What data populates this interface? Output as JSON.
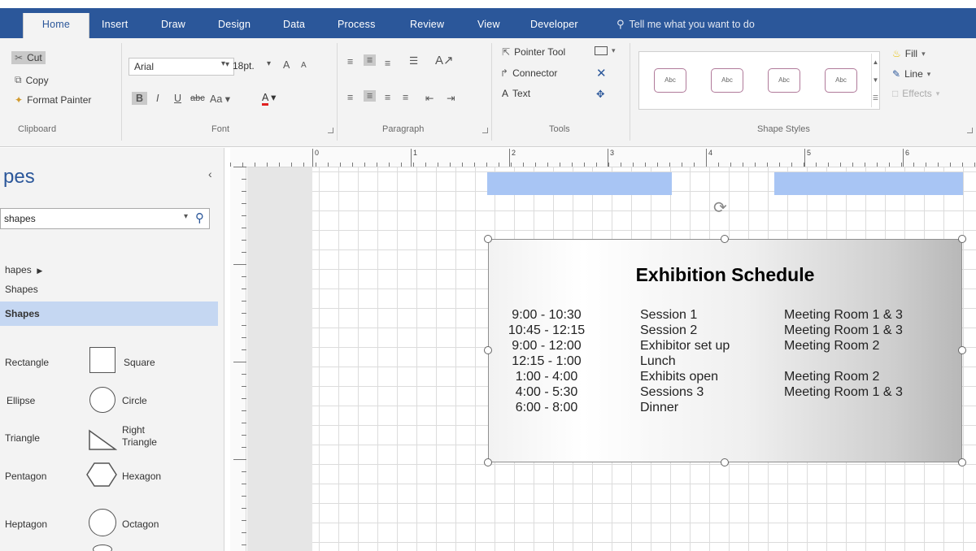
{
  "tabs": [
    "Home",
    "Insert",
    "Draw",
    "Design",
    "Data",
    "Process",
    "Review",
    "View",
    "Developer"
  ],
  "tell_me": "Tell me what you want to do",
  "clipboard": {
    "cut": "Cut",
    "copy": "Copy",
    "format_painter": "Format Painter",
    "label": "Clipboard"
  },
  "font": {
    "name": "Arial",
    "size": "18pt.",
    "grow": "A",
    "shrink": "A",
    "bold": "B",
    "italic": "I",
    "underline": "U",
    "strike": "abc",
    "case": "Aa",
    "color": "A",
    "label": "Font"
  },
  "paragraph": {
    "label": "Paragraph"
  },
  "tools": {
    "pointer": "Pointer Tool",
    "connector": "Connector",
    "text": "Text",
    "label": "Tools"
  },
  "shape_styles": {
    "sample": "Abc",
    "fill": "Fill",
    "line": "Line",
    "effects": "Effects",
    "label": "Shape Styles"
  },
  "pane": {
    "title": "pes",
    "search_text": "shapes",
    "items": [
      "hapes",
      "Shapes",
      "Shapes"
    ],
    "stencils": [
      {
        "left": "Rectangle",
        "right": "Square"
      },
      {
        "left": "Ellipse",
        "right": "Circle"
      },
      {
        "left": "Triangle",
        "right": "Right Triangle"
      },
      {
        "left": "Pentagon",
        "right": "Hexagon"
      },
      {
        "left": "Heptagon",
        "right": "Octagon"
      }
    ]
  },
  "ruler": {
    "numbers": [
      "0",
      "1",
      "2",
      "3",
      "4",
      "5",
      "6"
    ]
  },
  "shape": {
    "title": "Exhibition Schedule",
    "rows": [
      {
        "time": "9:00  -  10:30",
        "event": "Session 1",
        "room": "Meeting Room 1 & 3"
      },
      {
        "time": "10:45  -  12:15",
        "event": "Session 2",
        "room": "Meeting Room 1 & 3"
      },
      {
        "time": "9:00  -  12:00",
        "event": "Exhibitor set up",
        "room": "Meeting Room 2"
      },
      {
        "time": "12:15  -  1:00",
        "event": "Lunch",
        "room": ""
      },
      {
        "time": "1:00  -  4:00",
        "event": "Exhibits open",
        "room": "Meeting Room 2"
      },
      {
        "time": "4:00  -  5:30",
        "event": "Sessions 3",
        "room": "Meeting Room 1 & 3"
      },
      {
        "time": "6:00  -  8:00",
        "event": "Dinner",
        "room": ""
      }
    ]
  },
  "colors": {
    "accent": "#2b579a",
    "selection": "#c5d7f2",
    "banner": "#a8c5f4"
  }
}
